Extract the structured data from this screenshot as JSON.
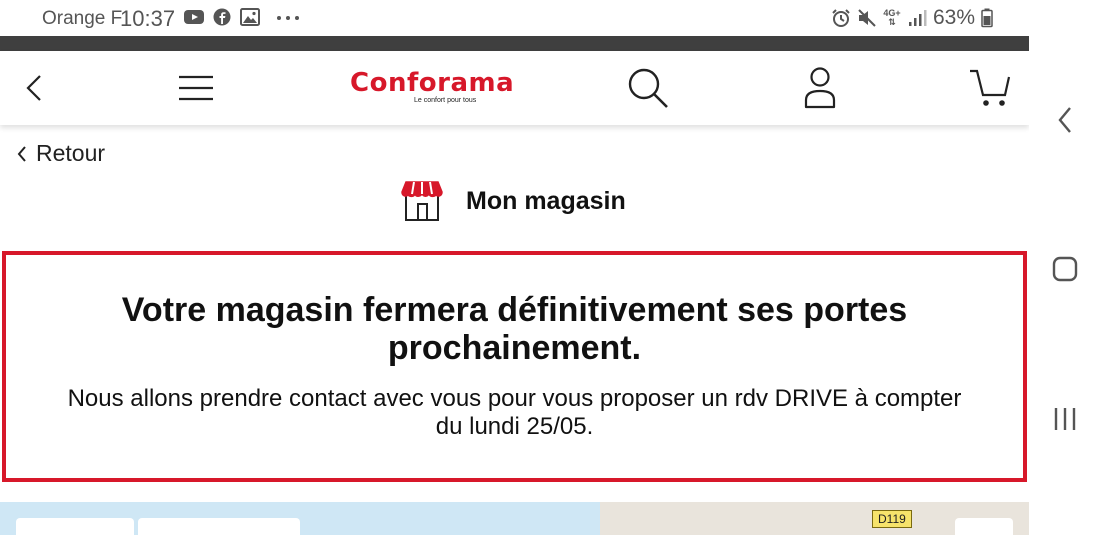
{
  "status_bar": {
    "carrier": "Orange F",
    "time": "10:37",
    "battery_percent": "63%",
    "network": "4G+",
    "icons": [
      "youtube-icon",
      "facebook-icon",
      "gallery-icon",
      "more-icon",
      "alarm-icon",
      "mute-icon",
      "network-icon",
      "signal-icon",
      "battery-icon"
    ]
  },
  "header": {
    "logo_name": "Conforama",
    "logo_tagline": "Le confort pour tous",
    "brand_color": "#d7182a",
    "icons": [
      "back-arrow-icon",
      "menu-icon",
      "search-icon",
      "account-icon",
      "cart-icon"
    ]
  },
  "back_link": {
    "label": "Retour"
  },
  "store": {
    "title": "Mon magasin",
    "icon": "store-icon"
  },
  "notice": {
    "heading": "Votre magasin fermera définitivement ses portes prochainement.",
    "body": "Nous allons prendre contact avec vous pour vous proposer un rdv DRIVE à compter du lundi 25/05.",
    "border_color": "#d7182a"
  },
  "map": {
    "road_label": "D119"
  },
  "android_nav": {
    "icons": [
      "back-icon",
      "home-icon",
      "recents-icon"
    ]
  }
}
